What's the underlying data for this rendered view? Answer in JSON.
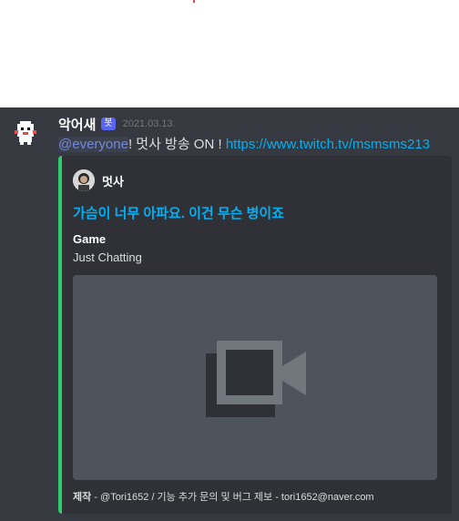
{
  "message": {
    "username": "악어새",
    "bot_tag": "봇",
    "timestamp": "2021.03.13.",
    "mention": "@everyone",
    "text": "! 멋사 방송 ON ! ",
    "link": "https://www.twitch.tv/msmsms213"
  },
  "embed": {
    "accent_color": "#2ecc71",
    "author_name": "멋사",
    "title": "가슴이 너무 아파요. 이건 무슨 병이죠",
    "field_name": "Game",
    "field_value": "Just Chatting",
    "video_icon": "video-camera-icon",
    "footer_prefix": "제작",
    "footer_text": " - @Tori1652 / 기능 추가 문의 및 버그 제보 - tori1652@naver.com"
  }
}
